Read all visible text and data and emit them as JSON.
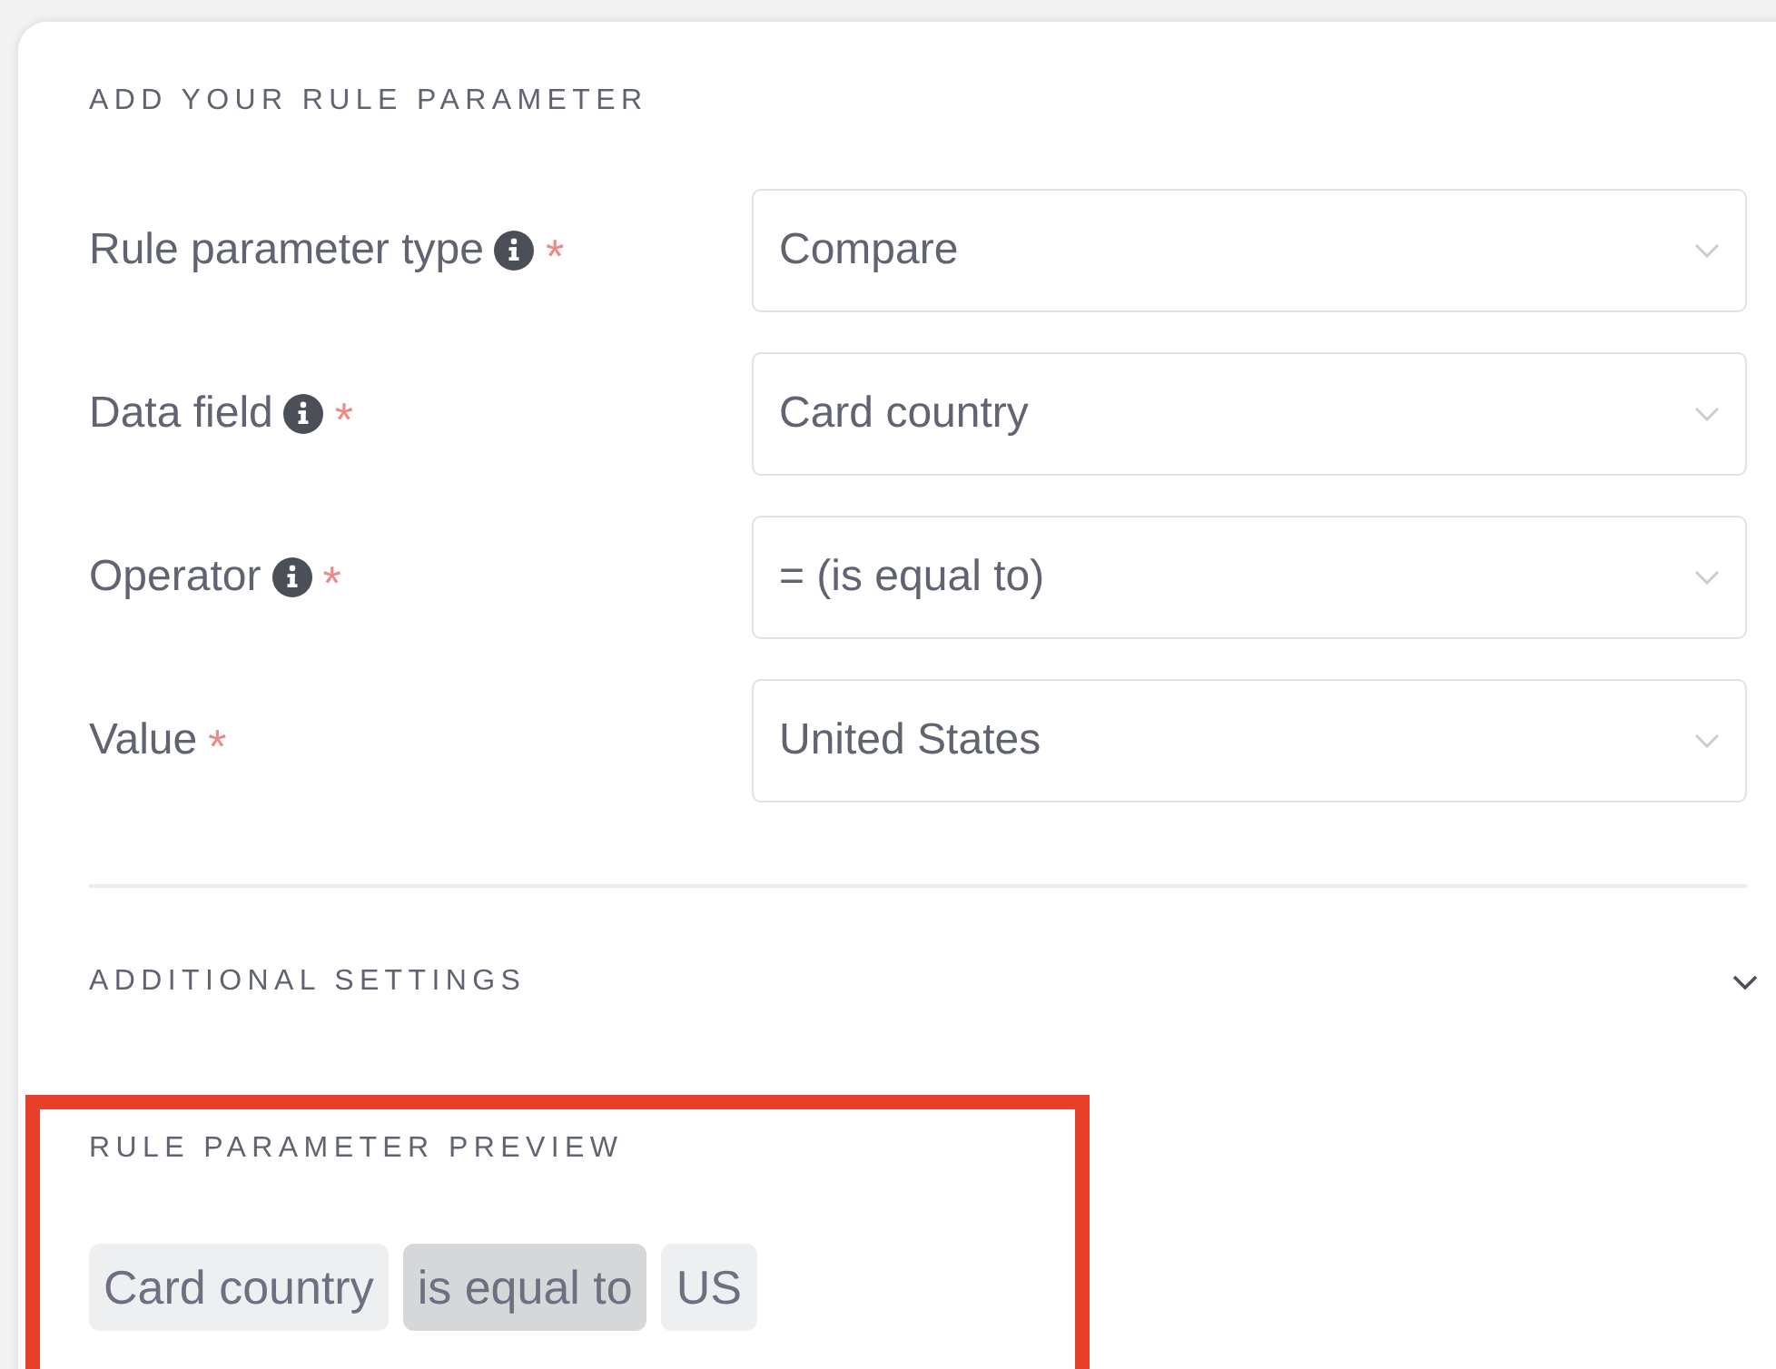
{
  "heading": "ADD YOUR RULE PARAMETER",
  "fields": [
    {
      "label": "Rule parameter type",
      "info": true,
      "required_mark": "*",
      "value": "Compare"
    },
    {
      "label": "Data field",
      "info": true,
      "required_mark": "*",
      "value": "Card country"
    },
    {
      "label": "Operator",
      "info": true,
      "required_mark": "*",
      "value": "= (is equal to)"
    },
    {
      "label": "Value",
      "info": false,
      "required_mark": "*",
      "value": "United States"
    }
  ],
  "additional_settings": {
    "label": "ADDITIONAL SETTINGS",
    "expanded": false
  },
  "preview": {
    "label": "RULE PARAMETER PREVIEW",
    "highlighted": true,
    "chips": [
      {
        "text": "Card country",
        "kind": "field"
      },
      {
        "text": "is equal to",
        "kind": "operator"
      },
      {
        "text": "US",
        "kind": "value"
      }
    ]
  }
}
